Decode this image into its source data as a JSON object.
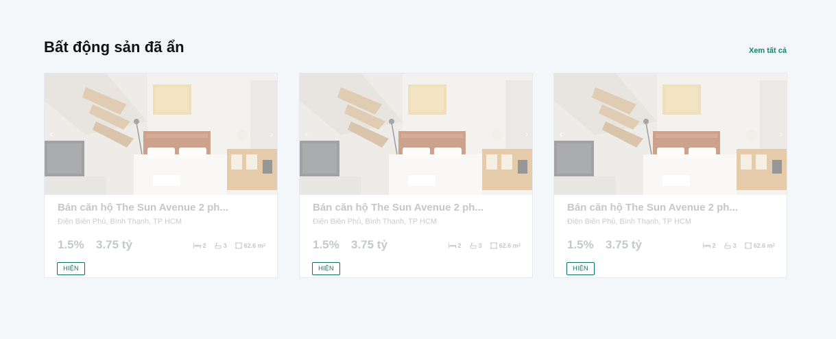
{
  "section": {
    "title": "Bất động sản đã ẩn",
    "view_all": "Xem tất cả"
  },
  "colors": {
    "accent": "#0b8a6a",
    "button_border": "#0b6e5f",
    "faded_text": "#c4c7cb",
    "background": "#f4f7fa"
  },
  "icons": {
    "prev": "chevron-left-icon",
    "next": "chevron-right-icon",
    "bed": "bed-icon",
    "bath": "bath-icon",
    "area": "area-icon"
  },
  "cards": [
    {
      "title": "Bán căn hộ The Sun Avenue 2 ph...",
      "address": "Điện Biên Phủ, Bình Thạnh, TP HCM",
      "rate": "1.5%",
      "price": "3.75 tỷ",
      "beds": "2",
      "baths": "3",
      "area": "62.6 m",
      "area_sup": "2",
      "action": "HIỆN",
      "prev_arrow": "‹",
      "next_arrow": "›"
    },
    {
      "title": "Bán căn hộ The Sun Avenue 2 ph...",
      "address": "Điện Biên Phủ, Bình Thạnh, TP HCM",
      "rate": "1.5%",
      "price": "3.75 tỷ",
      "beds": "2",
      "baths": "3",
      "area": "62.6 m",
      "area_sup": "2",
      "action": "HIỆN",
      "prev_arrow": "‹",
      "next_arrow": "›"
    },
    {
      "title": "Bán căn hộ The Sun Avenue 2 ph...",
      "address": "Điện Biên Phủ, Bình Thạnh, TP HCM",
      "rate": "1.5%",
      "price": "3.75 tỷ",
      "beds": "2",
      "baths": "3",
      "area": "62.6 m",
      "area_sup": "2",
      "action": "HIỆN",
      "prev_arrow": "‹",
      "next_arrow": "›"
    }
  ]
}
